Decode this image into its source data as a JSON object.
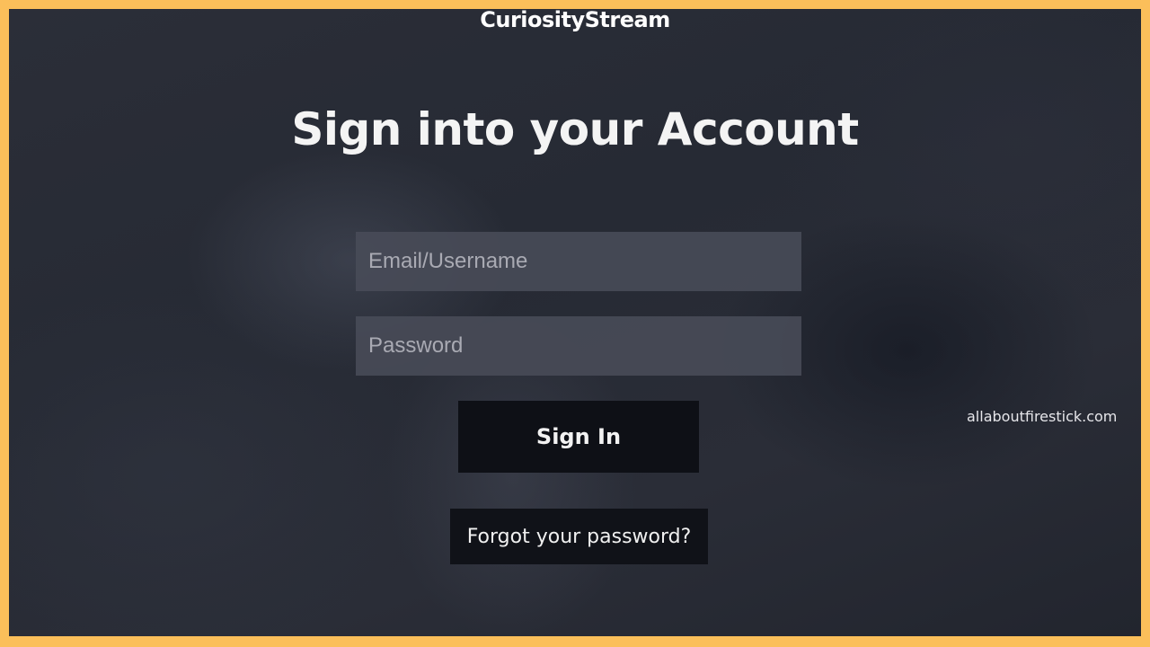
{
  "app": {
    "logo_text": "CuriosityStream"
  },
  "page": {
    "title": "Sign into your Account"
  },
  "form": {
    "email_placeholder": "Email/Username",
    "password_placeholder": "Password",
    "sign_in_label": "Sign In",
    "forgot_label": "Forgot your password?"
  },
  "watermark": {
    "text": "allaboutfirestick.com"
  },
  "colors": {
    "frame_border": "#fbbf5a",
    "background": "#2a2d37",
    "input_background": "#484b58",
    "button_background": "#0e1016"
  }
}
